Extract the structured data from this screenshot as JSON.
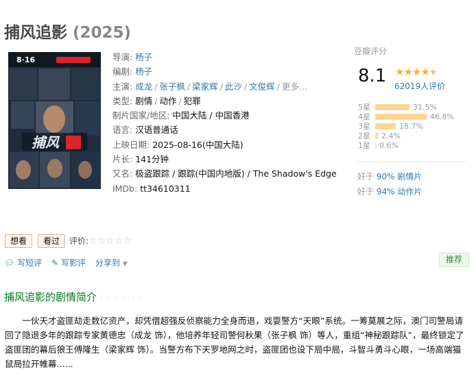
{
  "title": {
    "name": "捕风追影",
    "year": "(2025)"
  },
  "poster": {
    "alt": "捕风追影 poster",
    "date_text": "8·16",
    "colors": {
      "bg": "#1e2c3c",
      "accent": "#d8262a"
    }
  },
  "info": {
    "director_label": "导演:",
    "director": "杨子",
    "writer_label": "编剧:",
    "writer": "杨子",
    "cast_label": "主演:",
    "cast": [
      "成龙",
      "张子枫",
      "梁家辉",
      "此沙",
      "文俊辉"
    ],
    "cast_more": "更多...",
    "genre_label": "类型:",
    "genres": [
      "剧情",
      "动作",
      "犯罪"
    ],
    "country_label": "制片国家/地区:",
    "country": "中国大陆 / 中国香港",
    "language_label": "语言:",
    "language": "汉语普通话",
    "release_label": "上映日期:",
    "release": "2025-08-16(中国大陆)",
    "runtime_label": "片长:",
    "runtime": "141分钟",
    "aka_label": "又名:",
    "aka": "极盗跟踪 / 跟踪(中国内地版) / The Shadow's Edge",
    "imdb_label": "IMDb:",
    "imdb": "tt34610311"
  },
  "rating": {
    "label": "豆瓣评分",
    "score": "8.1",
    "stars_value": 4.5,
    "count": "62019人评价",
    "bars": [
      {
        "label": "5星",
        "percent": "31.5%",
        "value": 31.5
      },
      {
        "label": "4星",
        "percent": "46.8%",
        "value": 46.8
      },
      {
        "label": "3星",
        "percent": "18.7%",
        "value": 18.7
      },
      {
        "label": "2星",
        "percent": "2.4%",
        "value": 2.4
      },
      {
        "label": "1星",
        "percent": "0.6%",
        "value": 0.6
      }
    ],
    "better": [
      {
        "prefix": "好于",
        "value": "90% 剧情片"
      },
      {
        "prefix": "好于",
        "value": "94% 动作片"
      }
    ]
  },
  "actions": {
    "want": "想看",
    "watched": "看过",
    "rate_label": "评价:",
    "rate_stars": "☆☆☆☆☆"
  },
  "links": {
    "write_review": "写短评",
    "write_long_review": "写影评",
    "share": "分享到",
    "recommend": "推荐"
  },
  "summary": {
    "title": "捕风追影的剧情简介",
    "dots": "· · · · · ·",
    "text": "一伙天才盗匪劫走数亿资产，却凭借超强反侦察能力全身而退，戏耍警方“天眼”系统。一筹莫展之际，澳门司警局请回了隐退多年的跟踪专家黄德忠（成龙 饰），他培养年轻司警何秋果（张子枫 饰）等人，重组“神秘跟踪队”，最终锁定了盗匪团的幕后狼王傅隆生（梁家辉 饰）。当警方布下天罗地网之时，盗匪团也设下局中局，斗智斗勇斗心眼，一场高端猫鼠局拉开帷幕......"
  }
}
